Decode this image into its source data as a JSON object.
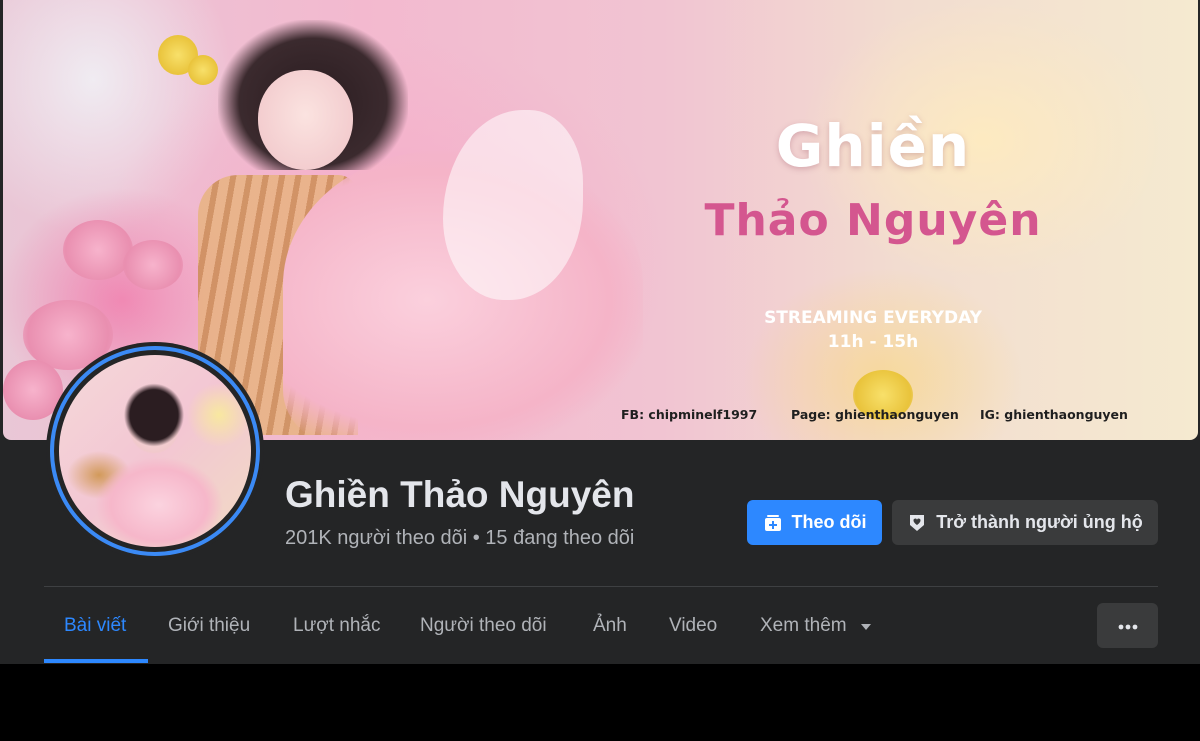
{
  "cover": {
    "title_line1": "Ghiền",
    "title_line2": "Thảo Nguyên",
    "stream_line1": "STREAMING EVERYDAY",
    "stream_line2": "11h - 15h",
    "social": {
      "fb": "FB: chipminelf1997",
      "page": "Page: ghienthaonguyen",
      "ig": "IG: ghienthaonguyen"
    }
  },
  "profile": {
    "name": "Ghiền Thảo Nguyên",
    "followers_text": "201K người theo dõi • 15 đang theo dõi"
  },
  "actions": {
    "follow_label": "Theo dõi",
    "support_label": "Trở thành người ủng hộ"
  },
  "tabs": [
    {
      "label": "Bài viết",
      "active": true
    },
    {
      "label": "Giới thiệu",
      "active": false
    },
    {
      "label": "Lượt nhắc",
      "active": false
    },
    {
      "label": "Người theo dõi",
      "active": false
    },
    {
      "label": "Ảnh",
      "active": false
    },
    {
      "label": "Video",
      "active": false
    },
    {
      "label": "Xem thêm",
      "active": false
    }
  ],
  "colors": {
    "accent": "#2d88ff",
    "background": "#242526",
    "button_secondary": "#3a3b3c",
    "text_primary": "#e4e6eb",
    "text_secondary": "#b0b3b8"
  },
  "icons": {
    "follow": "follow-box-plus-icon",
    "support": "support-badge-icon",
    "more_tabs": "caret-down-icon",
    "more_options": "ellipsis-icon"
  }
}
